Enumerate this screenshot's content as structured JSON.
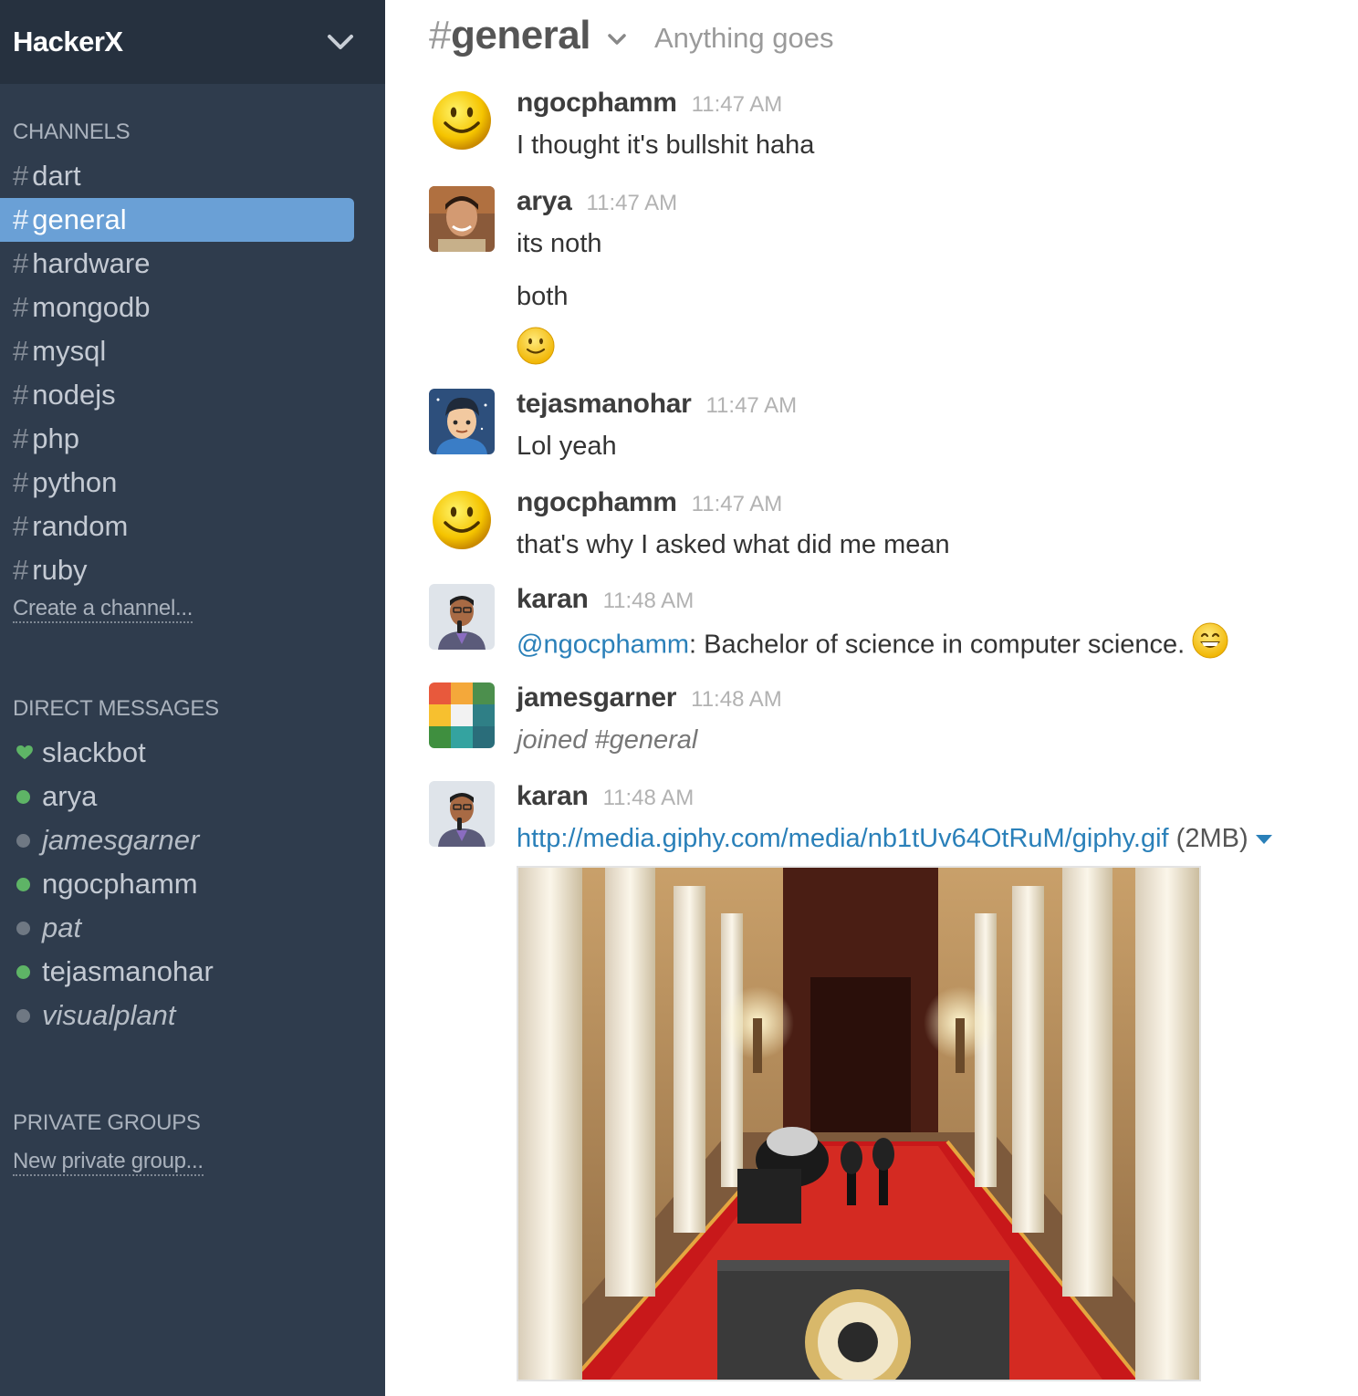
{
  "team": {
    "name": "HackerX"
  },
  "sidebar": {
    "channels_title": "CHANNELS",
    "channels": [
      {
        "name": "dart",
        "active": false
      },
      {
        "name": "general",
        "active": true
      },
      {
        "name": "hardware",
        "active": false
      },
      {
        "name": "mongodb",
        "active": false
      },
      {
        "name": "mysql",
        "active": false
      },
      {
        "name": "nodejs",
        "active": false
      },
      {
        "name": "php",
        "active": false
      },
      {
        "name": "python",
        "active": false
      },
      {
        "name": "random",
        "active": false
      },
      {
        "name": "ruby",
        "active": false
      }
    ],
    "hash": "#",
    "create_channel": "Create a channel...",
    "dm_title": "DIRECT MESSAGES",
    "dms": [
      {
        "name": "slackbot",
        "status": "bot"
      },
      {
        "name": "arya",
        "status": "online"
      },
      {
        "name": "jamesgarner",
        "status": "away"
      },
      {
        "name": "ngocphamm",
        "status": "online"
      },
      {
        "name": "pat",
        "status": "away"
      },
      {
        "name": "tejasmanohar",
        "status": "online"
      },
      {
        "name": "visualplant",
        "status": "away"
      }
    ],
    "groups_title": "PRIVATE GROUPS",
    "new_group": "New private group..."
  },
  "header": {
    "hash": "#",
    "channel": "general",
    "purpose": "Anything goes"
  },
  "messages": [
    {
      "user": "ngocphamm",
      "time": "11:47 AM",
      "lines": [
        "I thought it's bullshit haha"
      ]
    },
    {
      "user": "arya",
      "time": "11:47 AM",
      "lines": [
        "its noth",
        "both"
      ],
      "emoji": "slight-smile-emoji"
    },
    {
      "user": "tejasmanohar",
      "time": "11:47 AM",
      "lines": [
        "Lol yeah"
      ]
    },
    {
      "user": "ngocphamm",
      "time": "11:47 AM",
      "lines": [
        "that's why I asked what did me mean"
      ]
    },
    {
      "user": "karan",
      "time": "11:48 AM",
      "mention": "@ngocphamm",
      "text": ": Bachelor of science in computer science. "
    },
    {
      "user": "jamesgarner",
      "time": "11:48 AM",
      "lines": [
        "joined #general"
      ]
    },
    {
      "user": "karan",
      "time": "11:48 AM",
      "link": "http://media.giphy.com/media/nb1tUv64OtRuM/giphy.gif",
      "size": " (2MB)"
    }
  ],
  "colors": {
    "sidebar_bg": "#2f3c4d",
    "active_channel": "#6aa0d6",
    "online": "#5eb466",
    "link": "#2a80b9"
  }
}
